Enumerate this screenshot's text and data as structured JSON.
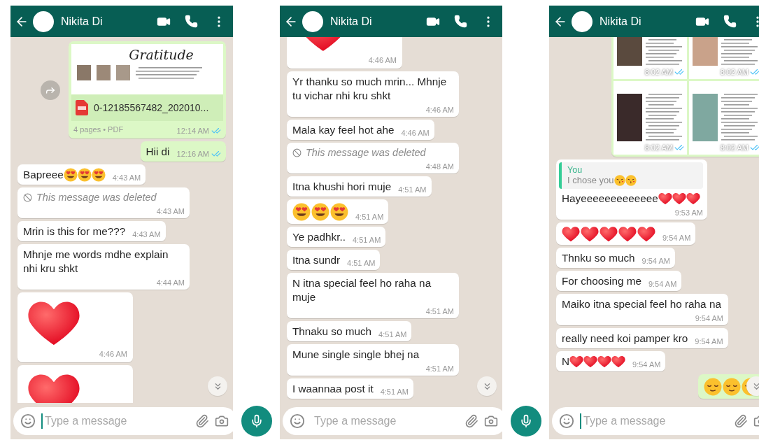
{
  "phones": [
    {
      "header": {
        "name": "Nikita Di"
      },
      "messages": [
        {
          "kind": "document",
          "outgoing": true,
          "title": "Gratitude",
          "file_name": "0-12185567482_202010...",
          "meta": "4 pages • PDF",
          "time": "12:14 AM",
          "read": true
        },
        {
          "kind": "text",
          "outgoing": true,
          "text": "Hii di",
          "time": "12:16 AM",
          "read": true
        },
        {
          "kind": "text",
          "outgoing": false,
          "text": "Bapreee",
          "emojis": [
            {
              "kind": "heart_eyes"
            },
            {
              "kind": "heart_eyes"
            },
            {
              "kind": "heart_eyes"
            }
          ],
          "time": "4:43 AM"
        },
        {
          "kind": "deleted",
          "outgoing": false,
          "text": "This message was deleted",
          "time": "4:43 AM"
        },
        {
          "kind": "text",
          "outgoing": false,
          "text": "Mrin is this for me???",
          "time": "4:43 AM"
        },
        {
          "kind": "text",
          "outgoing": false,
          "text": "Mhnje me words mdhe explain nhi kru shkt",
          "time": "4:44 AM"
        },
        {
          "kind": "sticker",
          "outgoing": false,
          "time": "4:46 AM"
        },
        {
          "kind": "sticker",
          "outgoing": false
        }
      ],
      "composer": {
        "placeholder": "Type a message",
        "focused": true
      }
    },
    {
      "header": {
        "name": "Nikita Di"
      },
      "messages": [
        {
          "kind": "sticker",
          "outgoing": false,
          "time": "4:46 AM"
        },
        {
          "kind": "text",
          "outgoing": false,
          "text": "Yr thanku so much mrin... Mhnje tu vichar nhi kru shkt",
          "time": "4:46 AM"
        },
        {
          "kind": "text",
          "outgoing": false,
          "text": "Mala kay feel hot ahe",
          "time": "4:46 AM"
        },
        {
          "kind": "deleted",
          "outgoing": false,
          "text": "This message was deleted",
          "time": "4:48 AM"
        },
        {
          "kind": "text",
          "outgoing": false,
          "text": "Itna khushi hori muje",
          "time": "4:51 AM"
        },
        {
          "kind": "emoji",
          "outgoing": false,
          "emojis": [
            {
              "kind": "heart_eyes"
            },
            {
              "kind": "heart_eyes"
            },
            {
              "kind": "heart_eyes"
            }
          ],
          "time": "4:51 AM"
        },
        {
          "kind": "text",
          "outgoing": false,
          "text": "Ye padhkr..",
          "time": "4:51 AM"
        },
        {
          "kind": "text",
          "outgoing": false,
          "text": "Itna sundr",
          "time": "4:51 AM"
        },
        {
          "kind": "text",
          "outgoing": false,
          "text": "N itna special feel ho raha na muje",
          "time": "4:51 AM"
        },
        {
          "kind": "text",
          "outgoing": false,
          "text": "Thnaku so much",
          "time": "4:51 AM"
        },
        {
          "kind": "text",
          "outgoing": false,
          "text": "Mune single single bhej na",
          "time": "4:51 AM"
        },
        {
          "kind": "text",
          "outgoing": false,
          "text": "I waannaa post it",
          "time": "4:51 AM"
        }
      ],
      "composer": {
        "placeholder": "Type a message",
        "focused": false
      }
    },
    {
      "header": {
        "name": "Nikita Di"
      },
      "messages": [
        {
          "kind": "image_grid",
          "outgoing": true,
          "images": [
            {
              "time": "8:02 AM",
              "read": true
            },
            {
              "time": "8:02 AM",
              "read": true
            },
            {
              "time": "8:02 AM",
              "read": true
            },
            {
              "time": "8:02 AM",
              "read": true
            }
          ]
        },
        {
          "kind": "reply",
          "outgoing": false,
          "quote_author": "You",
          "quote_text": "I chose you",
          "quote_emojis": [
            {
              "kind": "kiss"
            },
            {
              "kind": "kiss"
            }
          ],
          "text": "Hayeeeeeeeeeeeee",
          "emojis": [
            {
              "kind": "heart"
            },
            {
              "kind": "heart"
            },
            {
              "kind": "heart"
            }
          ],
          "time": "9:53 AM"
        },
        {
          "kind": "emoji",
          "outgoing": false,
          "emojis": [
            {
              "kind": "heart"
            },
            {
              "kind": "heart"
            },
            {
              "kind": "heart"
            },
            {
              "kind": "heart"
            },
            {
              "kind": "heart"
            }
          ],
          "time": "9:54 AM"
        },
        {
          "kind": "text",
          "outgoing": false,
          "text": "Thnku so much",
          "time": "9:54 AM"
        },
        {
          "kind": "text",
          "outgoing": false,
          "text": "For choosing me",
          "time": "9:54 AM"
        },
        {
          "kind": "text",
          "outgoing": false,
          "text": "Maiko itna special feel ho raha na",
          "time": "9:54 AM"
        },
        {
          "kind": "text",
          "outgoing": false,
          "text": "really need koi pamper kro",
          "time": "9:54 AM"
        },
        {
          "kind": "text",
          "outgoing": false,
          "text": "N",
          "emojis": [
            {
              "kind": "heart"
            },
            {
              "kind": "heart"
            },
            {
              "kind": "heart"
            },
            {
              "kind": "heart"
            }
          ],
          "time": "9:54 AM"
        },
        {
          "kind": "emoji",
          "outgoing": true,
          "emojis": [
            {
              "kind": "relieved"
            },
            {
              "kind": "relieved"
            },
            {
              "kind": "relieved"
            }
          ]
        }
      ],
      "composer": {
        "placeholder": "Type a message",
        "focused": true
      }
    }
  ]
}
